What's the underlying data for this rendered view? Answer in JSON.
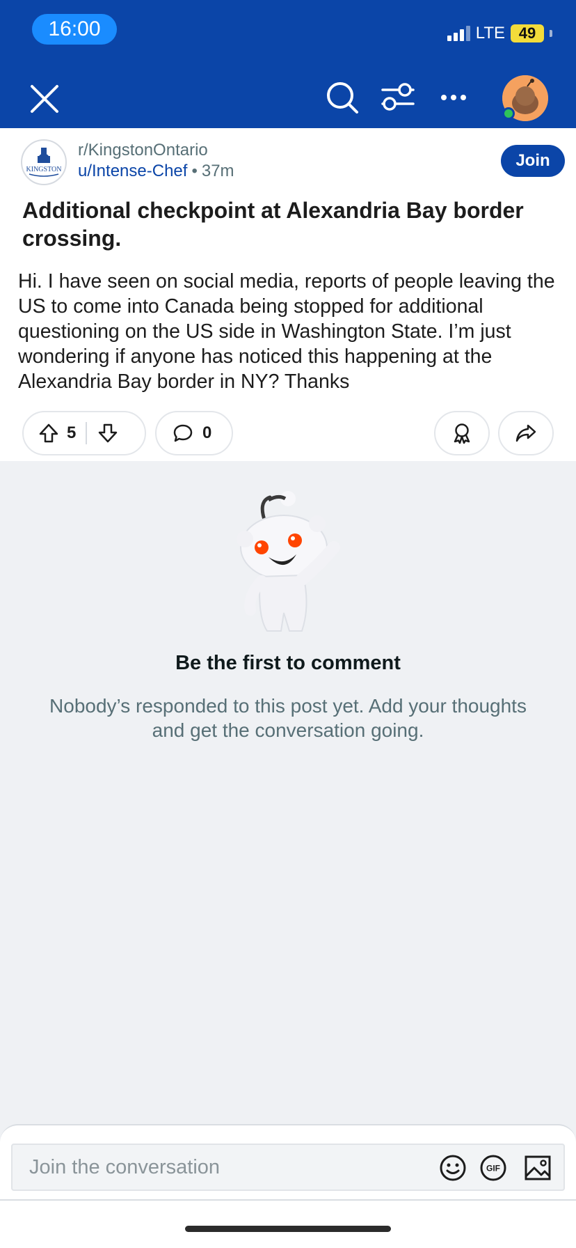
{
  "status_bar": {
    "time": "16:00",
    "network": "LTE",
    "battery": "49"
  },
  "header": {
    "close_icon": "close-icon",
    "search_icon": "search-icon",
    "filter_icon": "sort-filter-icon",
    "more_icon": "more-icon",
    "avatar": "user-avatar",
    "online_color": "#2ec45a",
    "accent": "#0b45a8"
  },
  "post": {
    "subreddit": "r/KingstonOntario",
    "author": "u/Intense-Chef",
    "separator": "•",
    "age": "37m",
    "join_label": "Join",
    "logo_text": "KINGSTON",
    "title": "Additional checkpoint at Alexandria Bay border crossing.",
    "body": "Hi. I have seen on social media, reports of people leaving the US to come into Canada being stopped for additional questioning on the US side in Washington State. I’m just wondering if anyone has noticed this happening at the Alexandria Bay border in NY? Thanks",
    "upvotes": "5",
    "comments": "0"
  },
  "empty_state": {
    "title": "Be the first to comment",
    "subtitle": "Nobody’s responded to this post yet. Add your thoughts and get the conversation going."
  },
  "composer": {
    "placeholder": "Join the conversation",
    "gif_label": "GIF"
  }
}
